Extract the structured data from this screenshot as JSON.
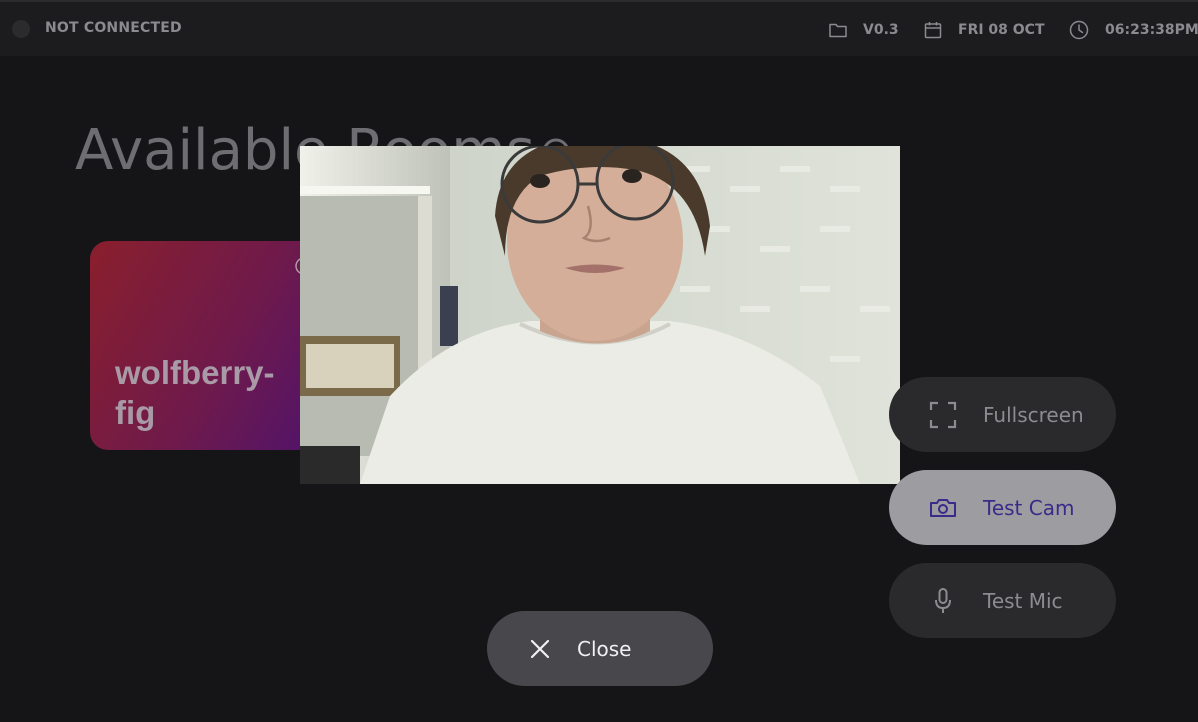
{
  "topbar": {
    "connection_status": "NOT CONNECTED",
    "version": "V0.3",
    "date": "FRI 08 OCT",
    "time": "06:23:38PM",
    "icons": {
      "status": "status-dot-icon",
      "version": "folder-icon",
      "date": "calendar-icon",
      "time": "clock-icon"
    }
  },
  "main": {
    "title": "Available Rooms",
    "refresh_icon": "refresh-icon",
    "rooms": [
      {
        "name": "wolfberry-fig"
      }
    ]
  },
  "overlay": {
    "camera_preview_label": "camera-preview",
    "actions": [
      {
        "label": "Fullscreen",
        "icon": "fullscreen-icon",
        "state": "idle"
      },
      {
        "label": "Test Cam",
        "icon": "camera-icon",
        "state": "active"
      },
      {
        "label": "Test Mic",
        "icon": "microphone-icon",
        "state": "idle"
      }
    ],
    "close_label": "Close",
    "close_icon": "close-icon"
  },
  "colors": {
    "background": "#151517",
    "topbar": "#1c1c1f",
    "button_idle": "#2a2a2d",
    "button_active": "#9c9ca1",
    "button_active_text": "#3a2a8a",
    "close_button": "#48484c",
    "room_gradient_start": "#8a1f2c",
    "room_gradient_end": "#3c0e80"
  }
}
